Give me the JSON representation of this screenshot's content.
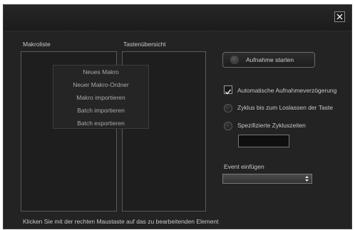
{
  "titlebar": {
    "close_icon": "close-icon"
  },
  "macro_list": {
    "label": "Makroliste"
  },
  "key_overview": {
    "label": "Tastenübersicht"
  },
  "context_menu": {
    "items": [
      {
        "label": "Neues Makro"
      },
      {
        "label": "Neuer Makro-Ordner"
      },
      {
        "label": "Makro importieren"
      },
      {
        "label": "Batch importieren"
      },
      {
        "label": "Batch exportieren"
      }
    ]
  },
  "record": {
    "button_label": "Aufnahme starten",
    "icon": "record-icon"
  },
  "options": {
    "auto_delay": {
      "label": "Automatische Aufnahmeverzögerung",
      "checked": true
    },
    "cycle_release": {
      "label": "Zyklus bis zum Loslassen der Taste",
      "selected": false
    },
    "specified_cycles": {
      "label": "Spezifizierte Zykluszeiten",
      "selected": false
    },
    "cycle_times_value": ""
  },
  "event": {
    "label": "Event einfügen",
    "selected_value": ""
  },
  "footer": {
    "hint": "Klicken Sie mit der rechten Maustaste auf das zu bearbeitenden Element"
  }
}
